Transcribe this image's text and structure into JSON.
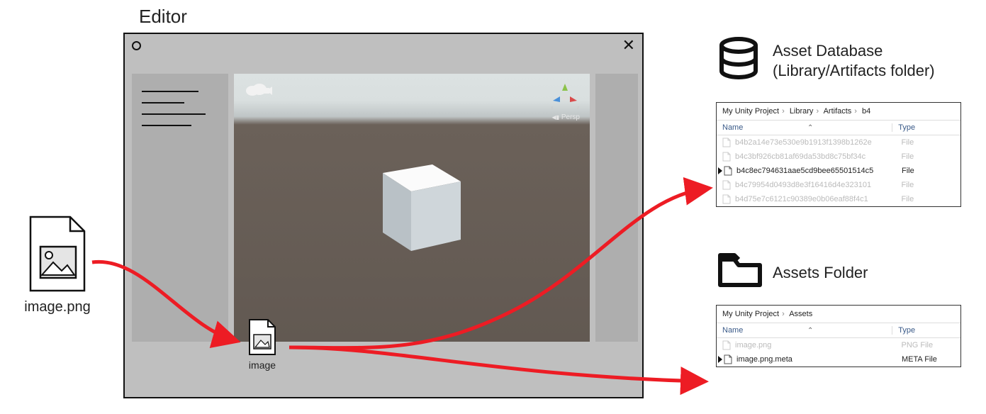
{
  "editor_title": "Editor",
  "source_file": {
    "name": "image.png"
  },
  "asset_thumb": {
    "name": "image"
  },
  "scene": {
    "persp_label": "Persp"
  },
  "db_section": {
    "title_line1": "Asset Database",
    "title_line2": "(Library/Artifacts folder)",
    "breadcrumb": [
      "My Unity Project",
      "Library",
      "Artifacts",
      "b4"
    ],
    "columns": {
      "name": "Name",
      "type": "Type"
    },
    "rows": [
      {
        "name": "b4b2a14e73e530e9b1913f1398b1262e",
        "type": "File",
        "highlight": false
      },
      {
        "name": "b4c3bf926cb81af69da53bd8c75bf34c",
        "type": "File",
        "highlight": false
      },
      {
        "name": "b4c8ec794631aae5cd9bee65501514c5",
        "type": "File",
        "highlight": true
      },
      {
        "name": "b4c79954d0493d8e3f16416d4e323101",
        "type": "File",
        "highlight": false
      },
      {
        "name": "b4d75e7c6121c90389e0b06eaf88f4c1",
        "type": "File",
        "highlight": false
      }
    ]
  },
  "assets_section": {
    "title": "Assets Folder",
    "breadcrumb": [
      "My Unity Project",
      "Assets"
    ],
    "columns": {
      "name": "Name",
      "type": "Type"
    },
    "rows": [
      {
        "name": "image.png",
        "type": "PNG File",
        "highlight": false
      },
      {
        "name": "image.png.meta",
        "type": "META File",
        "highlight": true
      }
    ]
  }
}
